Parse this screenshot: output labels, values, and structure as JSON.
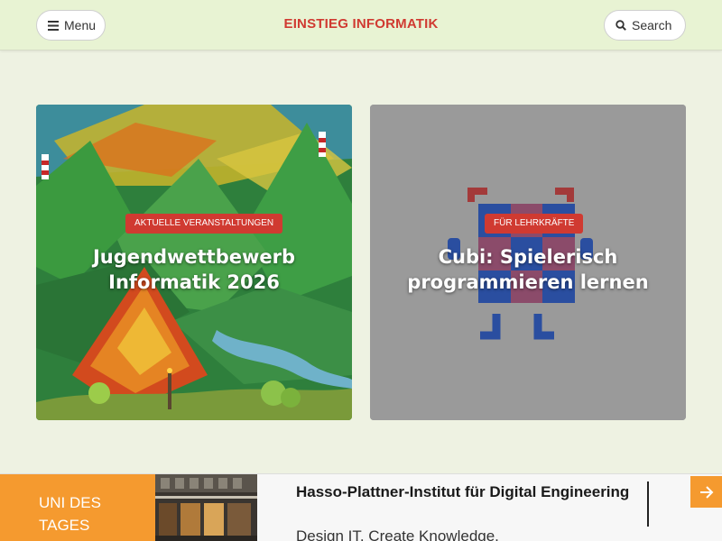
{
  "header": {
    "menu_label": "Menu",
    "brand": "EINSTIEG INFORMATIK",
    "search_label": "Search"
  },
  "cards": [
    {
      "badge": "AKTUELLE VERANSTALTUNGEN",
      "title": "Jugendwettbewerb Informatik 2026"
    },
    {
      "badge": "FÜR LEHRKRÄFTE",
      "title": "Cubi: Spielerisch programmieren lernen"
    }
  ],
  "uni_of_day": {
    "label": "UNI DES TAGES",
    "name": "Hasso-Plattner-Institut für Digital Engineering",
    "tagline": "Design IT. Create Knowledge."
  },
  "colors": {
    "brand_red": "#d03a31",
    "accent_orange": "#f59a2f",
    "header_bg": "#e8f3d3",
    "page_bg": "#eef2e2"
  },
  "icons": [
    "hamburger-icon",
    "search-icon",
    "arrow-right-icon"
  ]
}
